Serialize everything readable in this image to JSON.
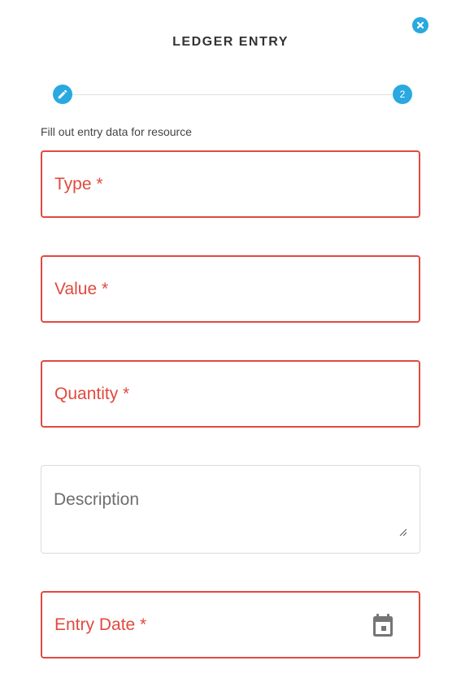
{
  "dialog": {
    "title": "LEDGER ENTRY",
    "close_icon": "close-circle-icon",
    "accent_color": "#29a9e0",
    "error_color": "#e04a3f"
  },
  "stepper": {
    "steps": [
      {
        "icon": "pencil-icon",
        "label": ""
      },
      {
        "icon": "",
        "label": "2"
      }
    ]
  },
  "form": {
    "instructions": "Fill out entry data for resource",
    "fields": {
      "type": {
        "label": "Type *",
        "value": "",
        "required": true,
        "state": "error"
      },
      "value": {
        "label": "Value *",
        "value": "",
        "required": true,
        "state": "error"
      },
      "quantity": {
        "label": "Quantity *",
        "value": "",
        "required": true,
        "state": "error"
      },
      "description": {
        "label": "Description",
        "value": "",
        "required": false,
        "state": "normal"
      },
      "entry_date": {
        "label": "Entry Date *",
        "value": "",
        "required": true,
        "state": "error",
        "icon": "calendar-icon"
      }
    }
  }
}
